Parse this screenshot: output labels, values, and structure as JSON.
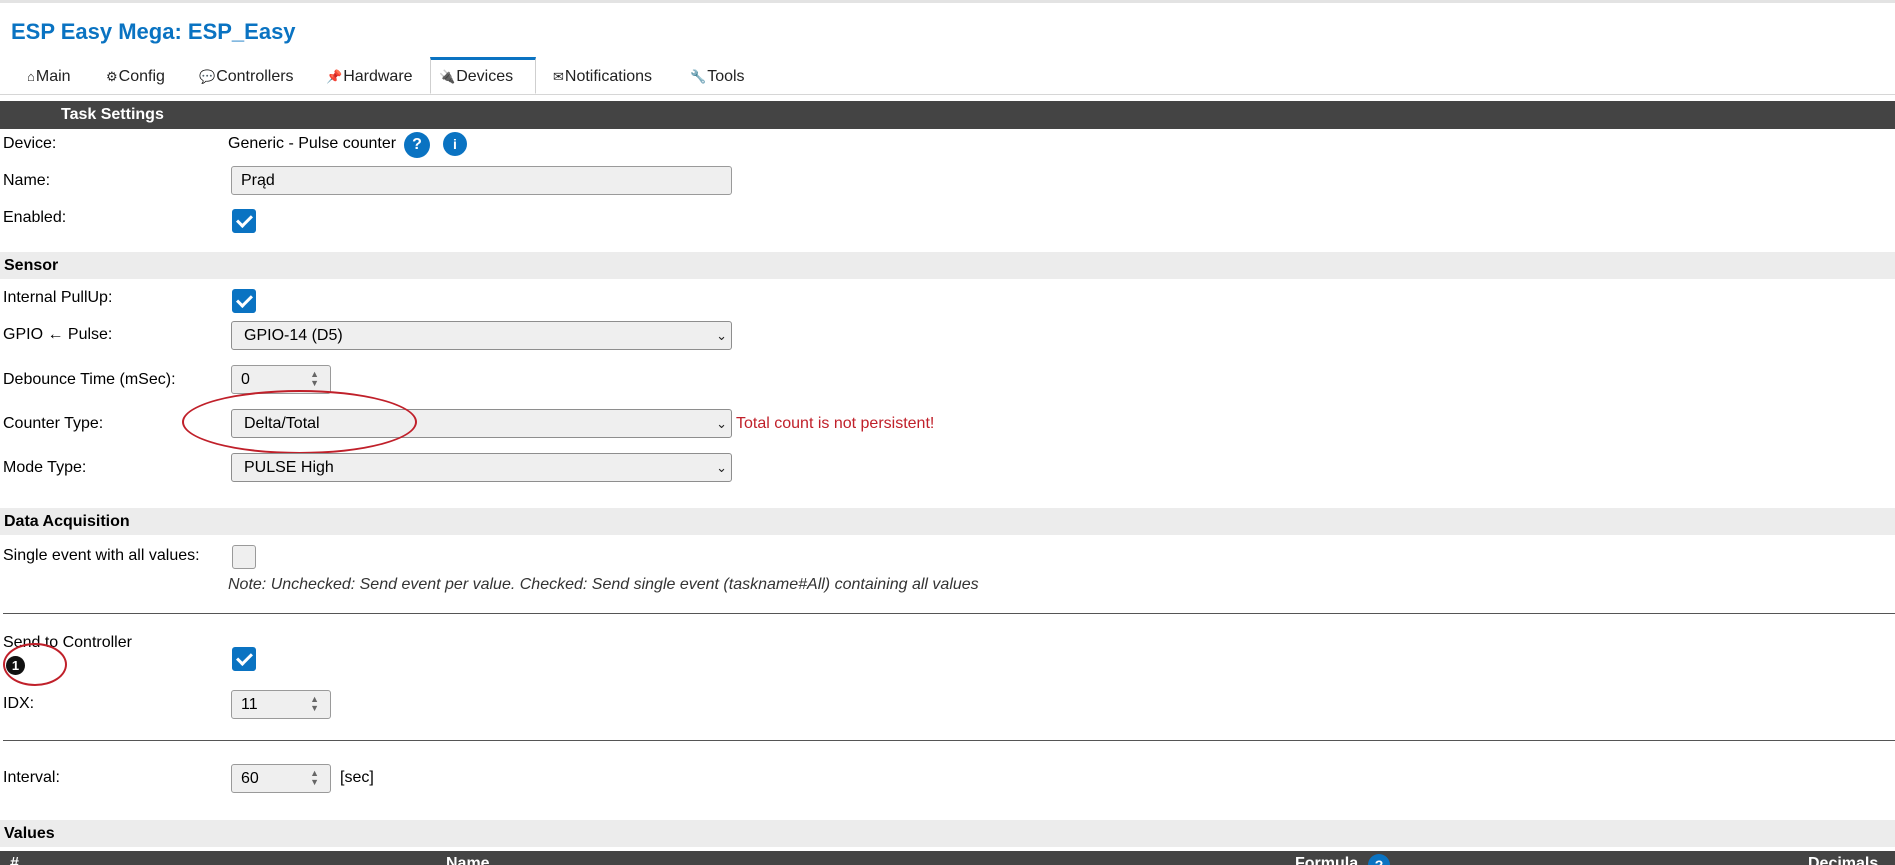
{
  "app": {
    "title": "ESP Easy Mega: ESP_Easy"
  },
  "tabs": [
    {
      "label": "Main",
      "icon": "⌂"
    },
    {
      "label": "Config",
      "icon": "⚙"
    },
    {
      "label": "Controllers",
      "icon": "💬"
    },
    {
      "label": "Hardware",
      "icon": "📌"
    },
    {
      "label": "Devices",
      "icon": "🔌"
    },
    {
      "label": "Notifications",
      "icon": "✉"
    },
    {
      "label": "Tools",
      "icon": "🔧"
    }
  ],
  "task": {
    "header": "Task Settings",
    "device_label": "Device:",
    "device_value": "Generic - Pulse counter",
    "help_glyph": "?",
    "info_glyph": "i",
    "name_label": "Name:",
    "name_value": "Prąd",
    "enabled_label": "Enabled:"
  },
  "sensor": {
    "header": "Sensor",
    "pullup_label": "Internal PullUp:",
    "gpio_label": "GPIO ← Pulse:",
    "gpio_value": "GPIO-14 (D5)",
    "debounce_label": "Debounce Time (mSec):",
    "debounce_value": "0",
    "counter_label": "Counter Type:",
    "counter_value": "Delta/Total",
    "counter_warning": "Total count is not persistent!",
    "mode_label": "Mode Type:",
    "mode_value": "PULSE High"
  },
  "acquisition": {
    "header": "Data Acquisition",
    "single_event_label": "Single event with all values:",
    "single_event_note": "Note: Unchecked: Send event per value. Checked: Send single event (taskname#All) containing all values",
    "send_label": "Send to Controller",
    "controller_marker": "1",
    "idx_label": "IDX:",
    "idx_value": "11",
    "interval_label": "Interval:",
    "interval_value": "60",
    "interval_unit": "[sec]"
  },
  "values": {
    "header": "Values",
    "col_hash": "#",
    "col_name": "Name",
    "col_formula": "Formula",
    "col_decimals": "Decimals"
  },
  "colors": {
    "accent": "#0a73c2",
    "header_bg": "#444444",
    "warning": "#c0202a"
  }
}
